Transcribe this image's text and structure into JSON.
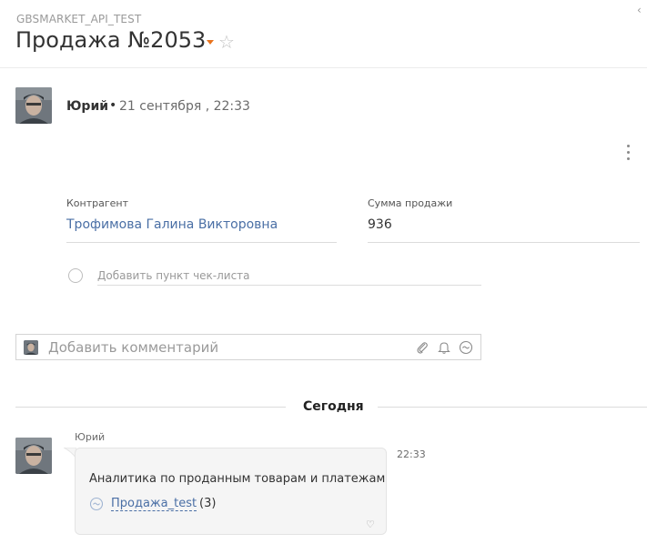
{
  "header": {
    "project_label": "GBSMARKET_API_TEST",
    "title": "Продажа №2053"
  },
  "post": {
    "author": "Юрий",
    "separator": "•",
    "date": "21 сентября , 22:33"
  },
  "fields": {
    "counterparty": {
      "label": "Контрагент",
      "value": "Трофимова Галина Викторовна"
    },
    "sale_amount": {
      "label": "Сумма продажи",
      "value": "936"
    }
  },
  "checklist": {
    "placeholder": "Добавить пункт чек-листа"
  },
  "comment": {
    "placeholder": "Добавить комментарий"
  },
  "feed": {
    "day_label": "Сегодня",
    "message": {
      "author": "Юрий",
      "time": "22:33",
      "text": "Аналитика по проданным товарам и платежам",
      "link_label": "Продажа_test",
      "link_count": "(3)"
    }
  },
  "colors": {
    "accent_orange": "#e8731e",
    "link_blue": "#4a6fa5"
  },
  "icons": [
    "chevron-left-icon",
    "caret-down-icon",
    "star-icon",
    "more-vertical-icon",
    "attach-icon",
    "bell-icon",
    "emoji-icon",
    "sale-link-icon",
    "heart-icon"
  ]
}
